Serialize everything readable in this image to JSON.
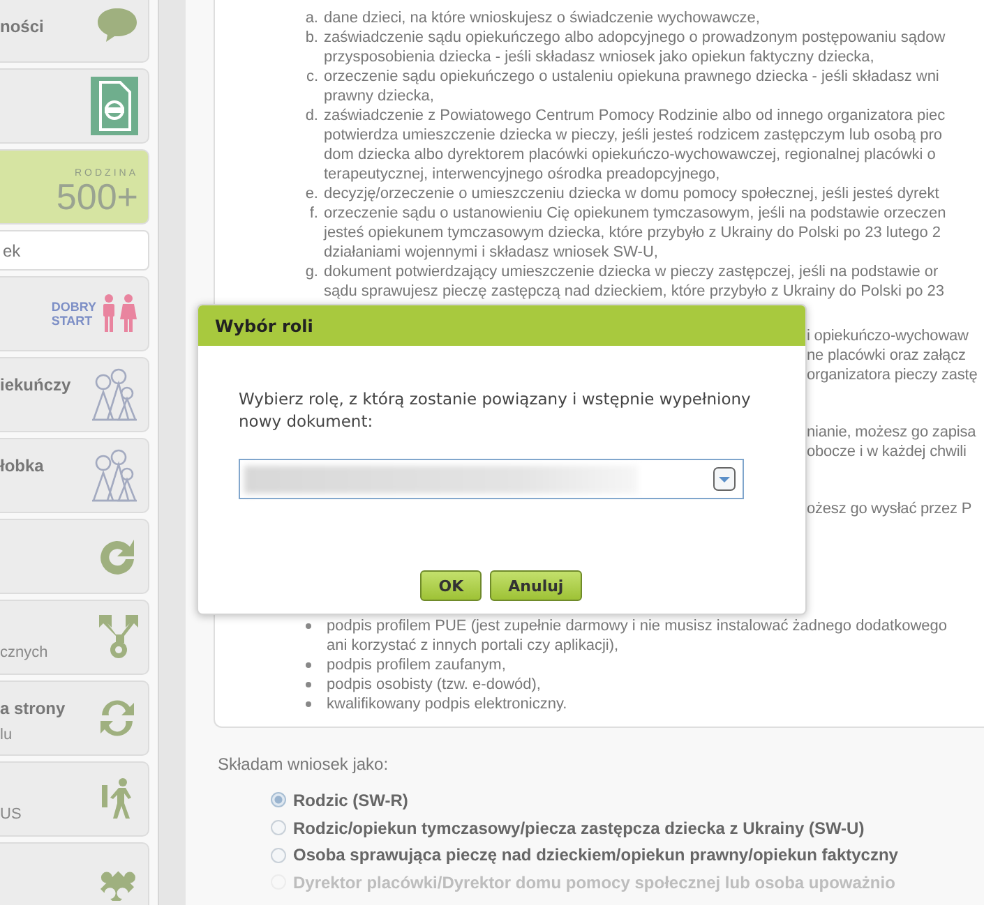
{
  "sidebar": {
    "items": [
      {
        "kind": "tile",
        "title": "ności",
        "selected": false
      },
      {
        "kind": "tile",
        "selected": false
      },
      {
        "kind": "logo500",
        "logo_small": "RODZINA",
        "logo_big": "500+",
        "selected": true
      },
      {
        "kind": "field",
        "value": "ek",
        "selected": false
      },
      {
        "kind": "logoDS",
        "logo_lines": [
          "DOBRY",
          "START"
        ],
        "selected": false
      },
      {
        "kind": "tile",
        "title": "iekuńczy",
        "selected": false
      },
      {
        "kind": "tile",
        "title": "łobka",
        "selected": false
      },
      {
        "kind": "tile",
        "selected": false
      },
      {
        "kind": "tile",
        "subtitle": "cznych",
        "selected": false
      },
      {
        "kind": "tile",
        "title": "a strony",
        "subtitle": "lu",
        "selected": false
      },
      {
        "kind": "tile",
        "subtitle": "US",
        "selected": false
      },
      {
        "kind": "tile",
        "selected": false
      }
    ]
  },
  "documents": [
    {
      "letter": "a.",
      "lines": [
        "dane dzieci, na które wnioskujesz o świadczenie wychowawcze,"
      ]
    },
    {
      "letter": "b.",
      "lines": [
        "zaświadczenie sądu opiekuńczego albo adopcyjnego o prowadzonym postępowaniu sądow",
        "przysposobienia dziecka - jeśli składasz wniosek jako opiekun faktyczny dziecka,"
      ]
    },
    {
      "letter": "c.",
      "lines": [
        "orzeczenie sądu opiekuńczego o ustaleniu opiekuna prawnego dziecka - jeśli składasz wni",
        "prawny dziecka,"
      ]
    },
    {
      "letter": "d.",
      "lines": [
        "zaświadczenie z Powiatowego Centrum Pomocy Rodzinie albo od innego organizatora piec",
        "potwierdza umieszczenie dziecka w pieczy, jeśli jesteś rodzicem zastępczym lub osobą pro",
        "dom dziecka albo dyrektorem placówki opiekuńczo-wychowawczej, regionalnej placówki o",
        "terapeutycznej, interwencyjnego ośrodka preadopcyjnego,"
      ]
    },
    {
      "letter": "e.",
      "lines": [
        "decyzję/orzeczenie o umieszczeniu dziecka w domu pomocy społecznej, jeśli jesteś dyrekt"
      ]
    },
    {
      "letter": "f.",
      "lines": [
        "orzeczenie sądu o ustanowieniu Cię opiekunem tymczasowym, jeśli na podstawie orzeczen",
        "jesteś opiekunem tymczasowym dziecka, które przybyło z Ukrainy do Polski po 23 lutego 2",
        "działaniami wojennymi i składasz wniosek SW-U,"
      ]
    },
    {
      "letter": "g.",
      "lines": [
        "dokument potwierdzający umieszczenie dziecka w pieczy zastępczej, jeśli na podstawie or",
        "sądu sprawujesz pieczę zastępczą nad dzieckiem, które przybyło z Ukrainy do Polski po 23"
      ]
    }
  ],
  "partly_hidden_text": [
    [
      "i opiekuńczo-wychowaw",
      "ne placówki oraz załącz",
      "organizatora pieczy zastę"
    ],
    [
      "nianie, możesz go zapisa",
      "obocze i w każdej chwili"
    ],
    [
      "ożesz go wysłać przez P"
    ]
  ],
  "signatures": [
    {
      "lines": [
        "podpis profilem PUE (jest zupełnie darmowy i nie musisz instalować żadnego dodatkowego",
        "ani korzystać z innych portali czy aplikacji),"
      ]
    },
    {
      "lines": [
        "podpis profilem zaufanym,"
      ]
    },
    {
      "lines": [
        "podpis osobisty (tzw. e-dowód),"
      ]
    },
    {
      "lines": [
        "kwalifikowany podpis elektroniczny."
      ]
    }
  ],
  "applicant": {
    "label": "Składam wniosek jako:",
    "options": [
      {
        "label": "Rodzic (SW-R)",
        "selected": true,
        "disabled": false
      },
      {
        "label": "Rodzic/opiekun tymczasowy/piecza zastępcza dziecka z Ukrainy (SW-U)",
        "selected": false,
        "disabled": false
      },
      {
        "label": "Osoba sprawująca pieczę nad dzieckiem/opiekun prawny/opiekun faktyczny",
        "selected": false,
        "disabled": false
      },
      {
        "label": "Dyrektor placówki/Dyrektor domu pomocy społecznej lub osoba upoważnio",
        "selected": false,
        "disabled": true
      }
    ]
  },
  "dialog": {
    "title": "Wybór roli",
    "message": "Wybierz rolę, z którą zostanie powiązany i wstępnie wypełniony nowy dokument:",
    "buttons": [
      "OK",
      "Anuluj"
    ]
  }
}
